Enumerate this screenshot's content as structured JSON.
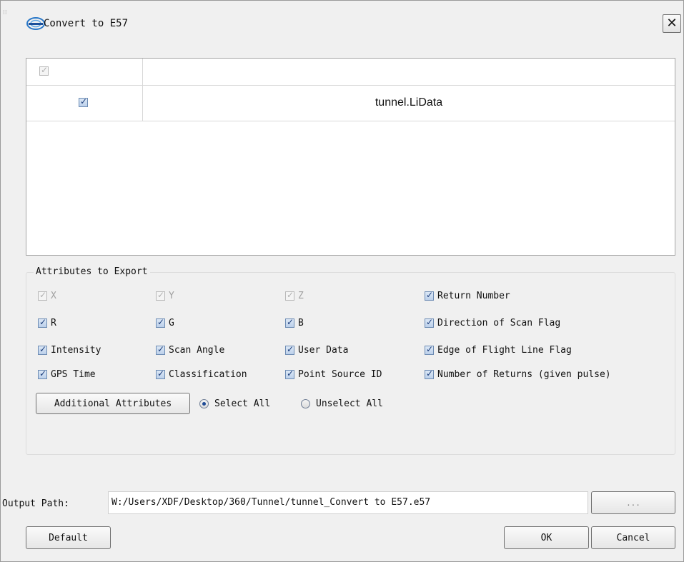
{
  "window": {
    "title": "Convert to E57",
    "close_glyph": "✕"
  },
  "file_table": {
    "header_checked": true,
    "rows": [
      {
        "checked": true,
        "name": "tunnel.LiData"
      }
    ]
  },
  "attributes": {
    "group_title": "Attributes to Export",
    "items": [
      {
        "label": "X",
        "checked": true,
        "disabled": true
      },
      {
        "label": "Y",
        "checked": true,
        "disabled": true
      },
      {
        "label": "Z",
        "checked": true,
        "disabled": true
      },
      {
        "label": "Return Number",
        "checked": true,
        "disabled": false
      },
      {
        "label": "R",
        "checked": true,
        "disabled": false
      },
      {
        "label": "G",
        "checked": true,
        "disabled": false
      },
      {
        "label": "B",
        "checked": true,
        "disabled": false
      },
      {
        "label": "Direction of Scan Flag",
        "checked": true,
        "disabled": false
      },
      {
        "label": "Intensity",
        "checked": true,
        "disabled": false
      },
      {
        "label": "Scan Angle",
        "checked": true,
        "disabled": false
      },
      {
        "label": "User Data",
        "checked": true,
        "disabled": false
      },
      {
        "label": "Edge of Flight Line Flag",
        "checked": true,
        "disabled": false
      },
      {
        "label": "GPS Time",
        "checked": true,
        "disabled": false
      },
      {
        "label": "Classification",
        "checked": true,
        "disabled": false
      },
      {
        "label": "Point Source ID",
        "checked": true,
        "disabled": false
      },
      {
        "label": "Number of Returns (given pulse)",
        "checked": true,
        "disabled": false
      }
    ],
    "additional_button": "Additional Attributes",
    "select_all": "Select All",
    "unselect_all": "Unselect All",
    "selected_option": "Select All"
  },
  "output": {
    "label": "Output Path:",
    "value": "W:/Users/XDF/Desktop/360/Tunnel/tunnel_Convert to E57.e57",
    "browse_label": "..."
  },
  "buttons": {
    "default": "Default",
    "ok": "OK",
    "cancel": "Cancel"
  },
  "colors": {
    "dialog_bg": "#f0f0f0",
    "checkbox_blue": "#1c3d7a"
  }
}
